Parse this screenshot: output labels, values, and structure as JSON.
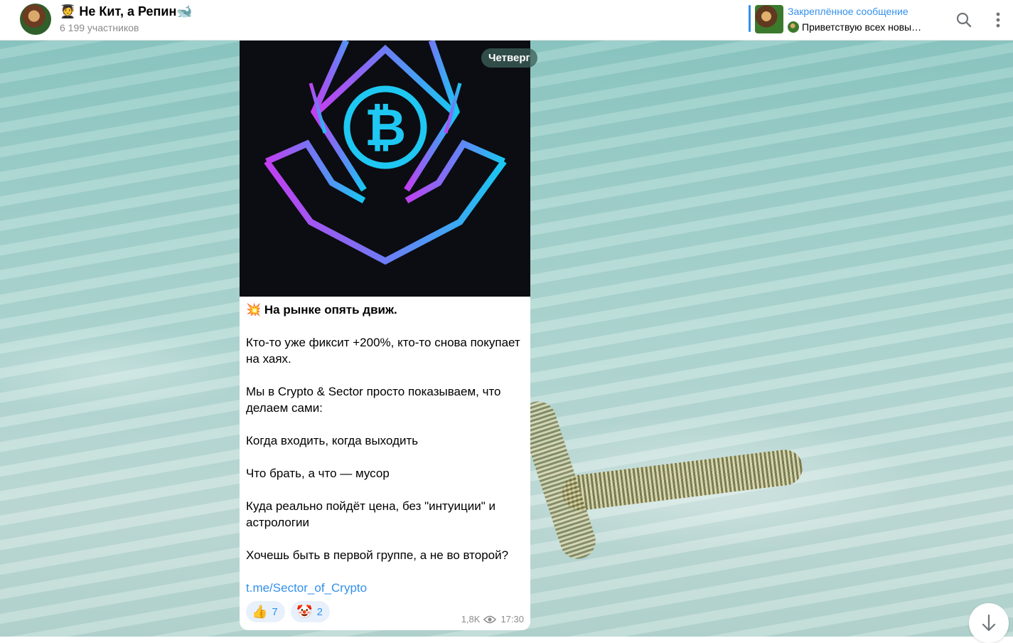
{
  "header": {
    "title": "🧑‍🎓 Не Кит, а Репин🐋",
    "members": "6 199 участников",
    "pinned_title": "Закреплённое сообщение",
    "pinned_text": "Приветствую всех новы…",
    "search_icon": "search-icon",
    "more_icon": "more-vertical-icon"
  },
  "date_pill": "Четверг",
  "message": {
    "image_icon": "bitcoin-logo",
    "lines": [
      "На рынке опять движ.",
      "Кто-то уже фиксит +200%, кто-то снова покупает на хаях.",
      "Мы в Crypto & Sector просто показываем, что делаем сами:",
      "Когда входить, когда выходить",
      "Что брать, а что — мусор",
      "Куда реально пойдёт цена, без \"интуиции\" и астрологии",
      "Хочешь быть в первой группе, а не во второй?"
    ],
    "first_line_emoji": "💥",
    "link": "t.me/Sector_of_Crypto",
    "reactions": [
      {
        "emoji": "👍",
        "count": "7"
      },
      {
        "emoji": "🤡",
        "count": "2"
      }
    ],
    "views": "1,8K",
    "time": "17:30"
  },
  "colors": {
    "accent": "#3390ec",
    "bitcoin_cyan": "#1ec8f2",
    "logo_purple": "#b23cf0"
  }
}
